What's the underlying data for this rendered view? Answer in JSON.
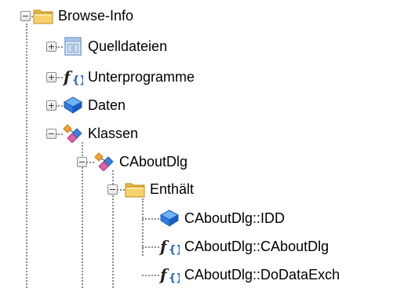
{
  "tree": {
    "root": {
      "label": "Browse-Info",
      "icon": "folder-icon",
      "expanded": true
    },
    "items": [
      {
        "label": "Quelldateien",
        "icon": "source-files-icon",
        "expanded": false
      },
      {
        "label": "Unterprogramme",
        "icon": "function-icon",
        "expanded": false
      },
      {
        "label": "Daten",
        "icon": "data-icon",
        "expanded": false
      },
      {
        "label": "Klassen",
        "icon": "class-icon",
        "expanded": true
      }
    ],
    "class_item": {
      "label": "CAboutDlg",
      "icon": "class-icon",
      "expanded": true
    },
    "contains_item": {
      "label": "Enthält",
      "icon": "folder-icon",
      "expanded": true
    },
    "members": [
      {
        "label": "CAboutDlg::IDD",
        "icon": "data-icon"
      },
      {
        "label": "CAboutDlg::CAboutDlg",
        "icon": "function-icon"
      },
      {
        "label": "CAboutDlg::DoDataExch",
        "icon": "function-icon"
      }
    ]
  },
  "colors": {
    "folder": "#f6d36a",
    "data": "#2f7de0",
    "function_f": "#222222",
    "function_braces": "#1f5fcf",
    "class_blue": "#3b7fd9",
    "class_pink": "#e05fa6",
    "class_orange": "#f3a531",
    "connector": "#8a8a8a"
  }
}
